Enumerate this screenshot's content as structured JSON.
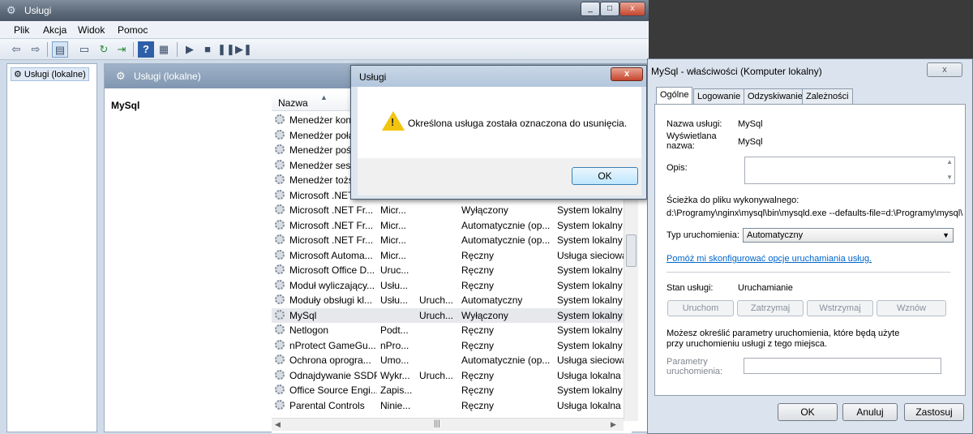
{
  "main_window": {
    "title": "Usługi",
    "menu": [
      "Plik",
      "Akcja",
      "Widok",
      "Pomoc"
    ],
    "tree_node": "Usługi (lokalne)",
    "content_header": "Usługi (lokalne)",
    "selected_service": "MySql",
    "column_name": "Nazwa",
    "rows": [
      {
        "name": "Menedżer kon",
        "desc": "",
        "status": "",
        "startup": "",
        "logon": ""
      },
      {
        "name": "Menedżer połą",
        "desc": "",
        "status": "",
        "startup": "",
        "logon": ""
      },
      {
        "name": "Menedżer poś",
        "desc": "",
        "status": "",
        "startup": "",
        "logon": ""
      },
      {
        "name": "Menedżer sesji",
        "desc": "",
        "status": "",
        "startup": "",
        "logon": ""
      },
      {
        "name": "Menedżer tożs",
        "desc": "",
        "status": "",
        "startup": "",
        "logon": ""
      },
      {
        "name": "Microsoft .NET",
        "desc": "",
        "status": "",
        "startup": "",
        "logon": ""
      },
      {
        "name": "Microsoft .NET Fr...",
        "desc": "Micr...",
        "status": "",
        "startup": "Wyłączony",
        "logon": "System lokalny"
      },
      {
        "name": "Microsoft .NET Fr...",
        "desc": "Micr...",
        "status": "",
        "startup": "Automatycznie (op...",
        "logon": "System lokalny"
      },
      {
        "name": "Microsoft .NET Fr...",
        "desc": "Micr...",
        "status": "",
        "startup": "Automatycznie (op...",
        "logon": "System lokalny"
      },
      {
        "name": "Microsoft Automa...",
        "desc": "Micr...",
        "status": "",
        "startup": "Ręczny",
        "logon": "Usługa sieciowa"
      },
      {
        "name": "Microsoft Office D...",
        "desc": "Uruc...",
        "status": "",
        "startup": "Ręczny",
        "logon": "System lokalny"
      },
      {
        "name": "Moduł wyliczający...",
        "desc": "Usłu...",
        "status": "",
        "startup": "Ręczny",
        "logon": "System lokalny"
      },
      {
        "name": "Moduły obsługi kl...",
        "desc": "Usłu...",
        "status": "Uruch...",
        "startup": "Automatyczny",
        "logon": "System lokalny"
      },
      {
        "name": "MySql",
        "desc": "",
        "status": "Uruch...",
        "startup": "Wyłączony",
        "logon": "System lokalny"
      },
      {
        "name": "Netlogon",
        "desc": "Podt...",
        "status": "",
        "startup": "Ręczny",
        "logon": "System lokalny"
      },
      {
        "name": "nProtect GameGu...",
        "desc": "nPro...",
        "status": "",
        "startup": "Ręczny",
        "logon": "System lokalny"
      },
      {
        "name": "Ochrona oprogra...",
        "desc": "Umo...",
        "status": "",
        "startup": "Automatycznie (op...",
        "logon": "Usługa sieciowa"
      },
      {
        "name": "Odnajdywanie SSDP",
        "desc": "Wykr...",
        "status": "Uruch...",
        "startup": "Ręczny",
        "logon": "Usługa lokalna"
      },
      {
        "name": "Office Source Engi...",
        "desc": "Zapis...",
        "status": "",
        "startup": "Ręczny",
        "logon": "System lokalny"
      },
      {
        "name": "Parental Controls",
        "desc": "Ninie...",
        "status": "",
        "startup": "Ręczny",
        "logon": "Usługa lokalna"
      }
    ]
  },
  "alert": {
    "title": "Usługi",
    "close": "x",
    "message": "Określona usługa została oznaczona do usunięcia.",
    "ok": "OK"
  },
  "props": {
    "title": "MySql - właściwości (Komputer lokalny)",
    "close": "x",
    "tabs": [
      "Ogólne",
      "Logowanie",
      "Odzyskiwanie",
      "Zależności"
    ],
    "service_name_label": "Nazwa usługi:",
    "service_name": "MySql",
    "display_name_label": "Wyświetlana nazwa:",
    "display_name": "MySql",
    "desc_label": "Opis:",
    "path_label": "Ścieżka do pliku wykonywalnego:",
    "path": "d:\\Programy\\nginx\\mysql\\bin\\mysqld.exe --defaults-file=d:\\Programy\\mysql\\",
    "startup_type_label": "Typ uruchomienia:",
    "startup_type": "Automatyczny",
    "help_link": "Pomóż mi skonfigurować opcje uruchamiania usług.",
    "status_label": "Stan usługi:",
    "status": "Uruchamianie",
    "btn_start": "Uruchom",
    "btn_stop": "Zatrzymaj",
    "btn_pause": "Wstrzymaj",
    "btn_resume": "Wznów",
    "params_info": "Możesz określić parametry uruchomienia, które będą użyte przy uruchomieniu usługi z tego miejsca.",
    "params_label": "Parametry uruchomienia:",
    "ok": "OK",
    "cancel": "Anuluj",
    "apply": "Zastosuj"
  }
}
